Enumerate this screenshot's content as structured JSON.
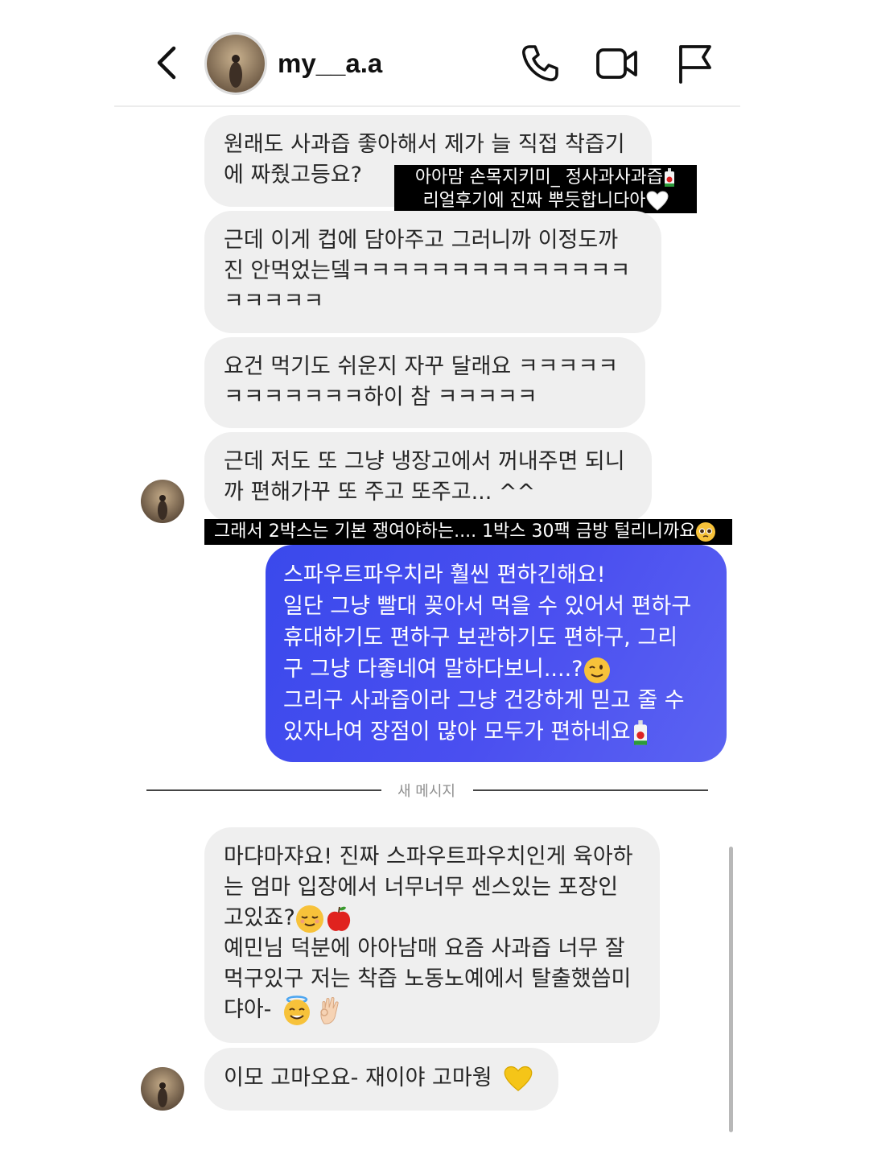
{
  "header": {
    "username": "my__a.a",
    "back_icon": "chevron-left-icon",
    "call_icon": "phone-icon",
    "video_icon": "video-camera-icon",
    "report_icon": "flag-icon"
  },
  "messages": {
    "m1": "원래도 사과즙 좋아해서 제가 늘 직접 착즙기\n에 짜줬고등요?",
    "m2": "근데 이게 컵에 담아주고 그러니까 이정도까\n진 안먹었는뎈ㅋㅋㅋㅋㅋㅋㅋㅋㅋㅋㅋㅋㅋㅋ\nㅋㅋㅋㅋㅋ",
    "m3": "요건 먹기도 쉬운지 자꾸 달래요 ㅋㅋㅋㅋㅋ\nㅋㅋㅋㅋㅋㅋㅋ하이 참 ㅋㅋㅋㅋㅋ",
    "m4": "근데 저도 또 그냥 냉장고에서 꺼내주면 되니\n까 편해가꾸 또 주고 또주고... ^^",
    "sent_line1": "스파우트파우치라 훨씬 편하긴해요!",
    "sent_line2": "일단 그냥 빨대 꽂아서 먹을 수 있어서 편하구\n휴대하기도 편하구 보관하기도 편하구, 그리\n구 그냥 다좋네여 말하다보니....?",
    "sent_line3": "그리구 사과즙이라 그냥 건강하게 믿고 줄 수\n있자나여 장점이 많아 모두가 편하네요",
    "divider": "새 메시지",
    "m5_a": "마댜마쟈요! 진짜 스파우트파우치인게 육아하\n는 엄마 입장에서 너무너무 센스있는 포장인\n고있죠?",
    "m5_b": "예민님 덕분에 아아남매 요즘 사과즙 너무 잘\n먹구있구 저는 착즙 노동노예에서 탈출했씁미\n댜아-",
    "m6": "이모 고마오요- 재이야 고마웡"
  },
  "captions": {
    "c1_line1": "아아맘 손목지키미_ 정사과사과즙",
    "c1_line2": "리얼후기에 진짜 뿌듯합니다아",
    "c2": "그래서 2박스는 기본 쟁여야하는.... 1박스 30팩 금방 털리니까요"
  },
  "colors": {
    "sent_bubble": "#4a4ff0",
    "received_bubble": "#efefef",
    "caption_bg": "#000000"
  }
}
